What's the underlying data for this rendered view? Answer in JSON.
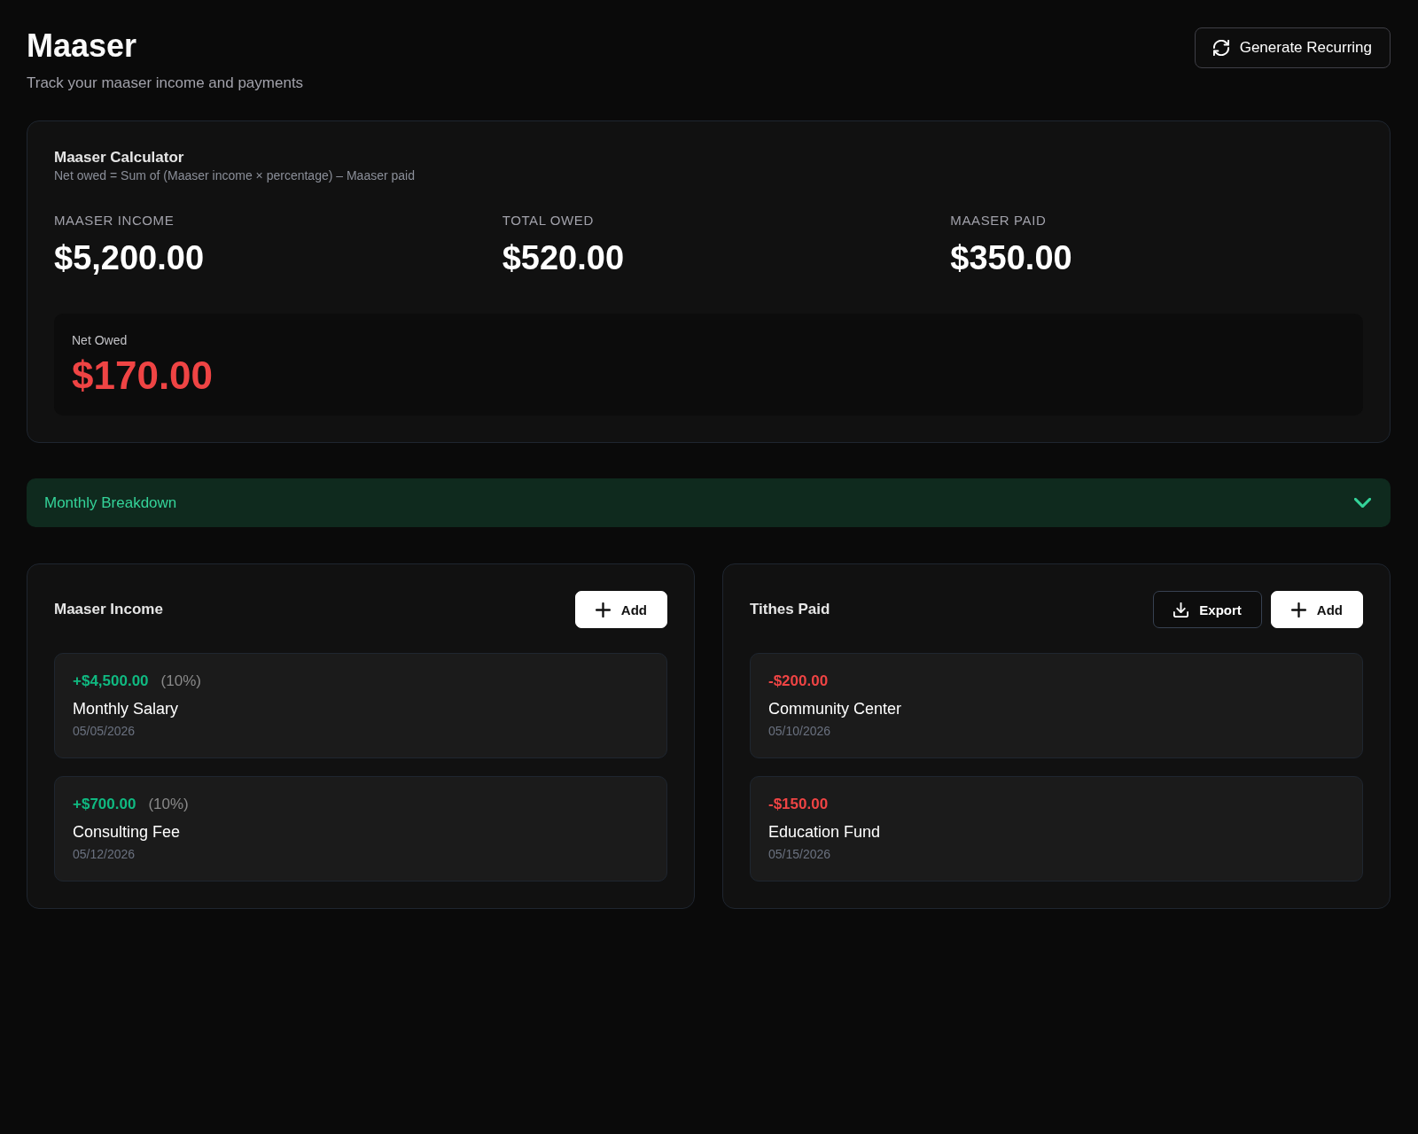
{
  "header": {
    "title": "Maaser",
    "subtitle": "Track your maaser income and payments",
    "action": {
      "label": "Generate Recurring"
    }
  },
  "calculator": {
    "title": "Maaser Calculator",
    "formula": "Net owed = Sum of (Maaser income × percentage) – Maaser paid",
    "stats": [
      {
        "label": "MAASER INCOME",
        "value": "$5,200.00"
      },
      {
        "label": "TOTAL OWED",
        "value": "$520.00"
      },
      {
        "label": "MAASER PAID",
        "value": "$350.00"
      }
    ],
    "net_owed": {
      "label": "Net Owed",
      "value": "$170.00"
    }
  },
  "monthly_breakdown": {
    "label": "Monthly Breakdown",
    "expanded": false
  },
  "panels": [
    {
      "title": "Maaser Income",
      "kind": "income",
      "buttons": [
        {
          "kind": "add",
          "label": "Add"
        }
      ],
      "entries": [
        {
          "amount": "+$4,500.00",
          "percent": "(10%)",
          "name": "Monthly Salary",
          "date": "05/05/2026"
        },
        {
          "amount": "+$700.00",
          "percent": "(10%)",
          "name": "Consulting Fee",
          "date": "05/12/2026"
        }
      ]
    },
    {
      "title": "Tithes Paid",
      "kind": "payment",
      "buttons": [
        {
          "kind": "export",
          "label": "Export"
        },
        {
          "kind": "add",
          "label": "Add"
        }
      ],
      "entries": [
        {
          "amount": "-$200.00",
          "name": "Community Center",
          "date": "05/10/2026"
        },
        {
          "amount": "-$150.00",
          "name": "Education Fund",
          "date": "05/15/2026"
        }
      ]
    }
  ]
}
